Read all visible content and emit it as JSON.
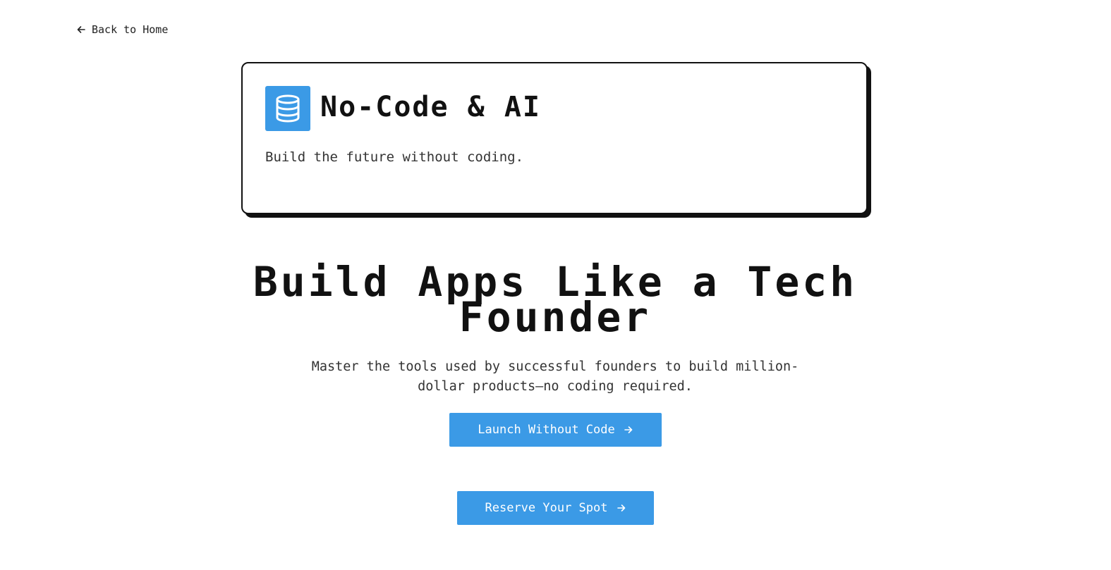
{
  "nav": {
    "back_label": "Back to Home",
    "back_icon": "arrow-left-icon"
  },
  "card": {
    "icon": "database-icon",
    "title": "No-Code & AI",
    "description": "Build the future without coding."
  },
  "hero": {
    "heading": "Build Apps Like a Tech Founder",
    "subheading": "Master the tools used by successful founders to build million-dollar products—no coding required."
  },
  "buttons": {
    "launch_label": "Launch Without Code",
    "reserve_label": "Reserve Your Spot",
    "arrow_icon": "arrow-right-icon"
  },
  "colors": {
    "accent": "#3b9ae6",
    "text": "#111111",
    "background": "#ffffff"
  }
}
